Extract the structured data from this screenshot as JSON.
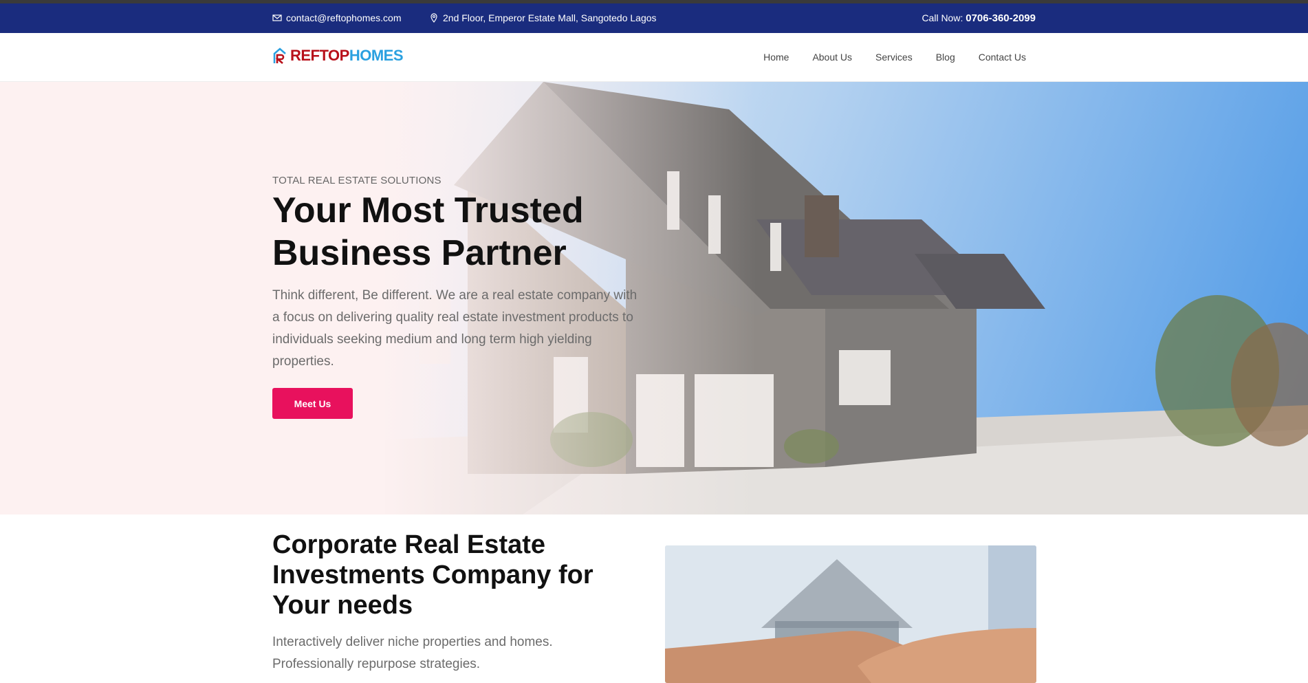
{
  "topbar": {
    "email": "contact@reftophomes.com",
    "address": "2nd Floor, Emperor Estate Mall, Sangotedo Lagos",
    "call_label": "Call Now:",
    "phone": "0706-360-2099",
    "email_icon": "envelope-icon",
    "address_icon": "map-pin-icon",
    "bg_color": "#1a2c7e"
  },
  "logo": {
    "part1": "REFTOP",
    "part2": "HOMES"
  },
  "nav": {
    "items": [
      "Home",
      "About Us",
      "Services",
      "Blog",
      "Contact Us"
    ]
  },
  "hero": {
    "eyebrow": "TOTAL REAL ESTATE SOLUTIONS",
    "title": "Your Most Trusted Business Partner",
    "text": "Think different, Be different. We are a real estate company with a focus on delivering quality real estate investment products to individuals seeking medium and long term high yielding properties.",
    "button": "Meet Us",
    "button_color": "#e8115d"
  },
  "section": {
    "title": "Corporate Real Estate Investments Company for Your needs",
    "text": "Interactively deliver niche properties and homes. Professionally repurpose strategies."
  }
}
